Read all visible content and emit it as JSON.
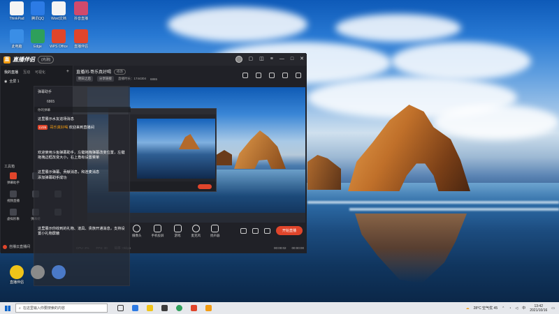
{
  "desktop": {
    "icons": [
      {
        "label": "ThinkPad",
        "color": "#f4f4f4"
      },
      {
        "label": "腾讯QQ",
        "color": "#2c7be5"
      },
      {
        "label": "Word文档",
        "color": "#f4f4f4"
      },
      {
        "label": "抖音直播",
        "color": "#d14a6c"
      },
      {
        "label": "此电脑",
        "color": "#3a8ee6"
      },
      {
        "label": "Edge",
        "color": "#2e9f5b"
      },
      {
        "label": "WPS Office",
        "color": "#e0452b"
      },
      {
        "label": "直播伴侣",
        "color": "#e0452b"
      }
    ],
    "bottom_icons": [
      {
        "label": "直播伴侣",
        "color": "#f0c419"
      },
      {
        "label": "",
        "color": "#8a8a8a"
      },
      {
        "label": "",
        "color": "#4a79c7"
      }
    ]
  },
  "app": {
    "name": "直播伴侣",
    "version": "(内测)",
    "tabs": [
      "我的直播",
      "互动",
      "可视化"
    ],
    "scene": "全屏 1",
    "tools_title": "工具箱",
    "tools": [
      {
        "label": "弹幕助手",
        "active": true
      },
      {
        "label": "",
        "active": false
      },
      {
        "label": "",
        "active": false
      },
      {
        "label": "视频直播",
        "active": false
      },
      {
        "label": "",
        "active": false
      },
      {
        "label": "",
        "active": false
      },
      {
        "label": "虚拟形象",
        "active": false
      },
      {
        "label": "弹幕姬",
        "active": false
      },
      {
        "label": "",
        "active": false
      }
    ],
    "left_bottom": "自播云直播间",
    "room_title": "直播间-哥乐真好喝",
    "room_tag": "修改",
    "sub_items": [
      "明日之后",
      "分享链接",
      "直播时长：1744304",
      "6865"
    ],
    "bottom_buttons": [
      "摄像头",
      "手机投屏",
      "游戏",
      "麦克风",
      "扬声器"
    ],
    "go_live": "开始直播",
    "status": {
      "cpu": "CPU: 2%",
      "frame": "FPS: 30",
      "bitrate": "码率: 0kbps",
      "time": "00:00:02",
      "time2": "00:00:00"
    }
  },
  "panel": {
    "header": "弹幕助手",
    "views": "6865",
    "section": "你的弹幕",
    "messages": [
      "这里展示水友进场消息",
      "欢迎来到直播间",
      "欢迎使用斗鱼弹幕助手，左键拖拽弹幕改变位置，左键拖拽边框改变大小，右上角有设置菜单",
      "这里展示弹幕、贡献消息，和连麦消息",
      "添加弹幕助手成功"
    ],
    "badge": "LV26",
    "vip_name": "哥乐真好喝",
    "footer": "这里展示你收到的礼物、道具、贵族开通消息，支持设置小礼物屏蔽"
  },
  "taskbar": {
    "search_placeholder": "在这里输入你要搜索的内容",
    "weather": "28°C 空气优 45",
    "time": "13:42",
    "date": "2021/10/16"
  }
}
